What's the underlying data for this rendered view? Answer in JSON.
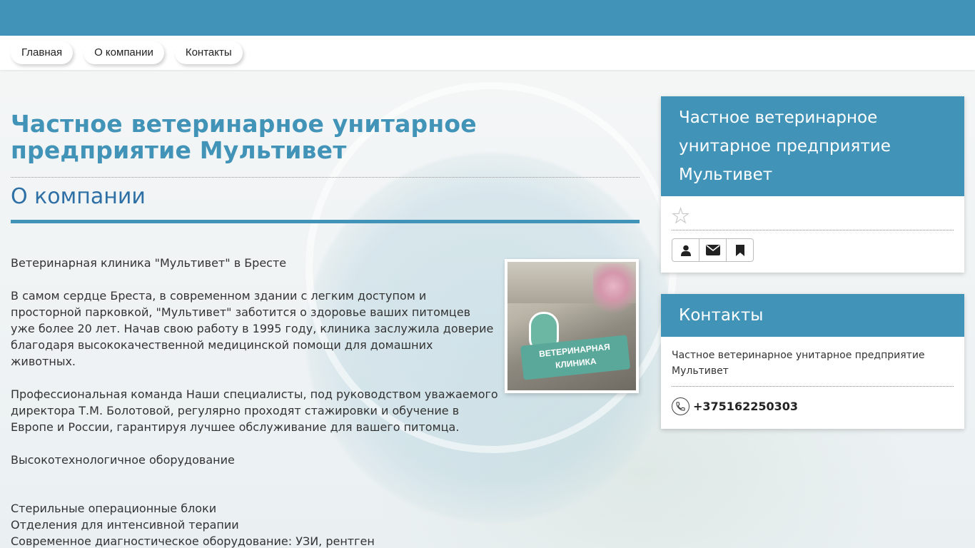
{
  "nav": {
    "items": [
      "Главная",
      "О компании",
      "Контакты"
    ]
  },
  "main": {
    "org_title": "Частное ветеринарное унитарное предприятие Мультивет",
    "section_title": "О компании",
    "paragraphs": [
      "Ветеринарная клиника \"Мультивет\" в Бресте",
      "В самом сердце Бреста, в современном здании с легким доступом и просторной парковкой, \"Мультивет\" заботится о здоровье ваших питомцев уже более 20 лет. Начав свою работу в 1995 году, клиника заслужила доверие благодаря высококачественной медицинской помощи для домашних животных.",
      "Профессиональная команда Наши специалисты, под руководством уважаемого директора Т.М. Болотовой, регулярно проходят стажировки и обучение в Европе и России, гарантируя лучшее обслуживание для вашего питомца.",
      "Высокотехнологичное оборудование"
    ],
    "list": [
      "Стерильные операционные блоки",
      "Отделения для интенсивной терапии",
      "Современное диагностическое оборудование: УЗИ, рентген"
    ],
    "photo_sign": [
      "ВЕТЕРИНАРНАЯ",
      "КЛИНИКА"
    ]
  },
  "sidebar": {
    "card1": {
      "title": "Частное ветеринарное унитарное предприятие Мультивет",
      "icons": [
        "user-icon",
        "envelope-icon",
        "bookmark-icon"
      ]
    },
    "card2": {
      "title": "Контакты",
      "name": "Частное ветеринарное унитарное предприятие Мультивет",
      "phone": "+375162250303"
    }
  },
  "colors": {
    "accent": "#4193b7",
    "section_title": "#2e6fa6"
  }
}
